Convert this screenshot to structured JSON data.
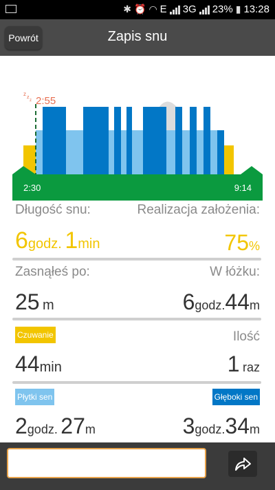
{
  "statusbar": {
    "network": "E",
    "network2": "3G",
    "battery": "23%",
    "time": "13:28"
  },
  "header": {
    "back_label": "Powrót",
    "title": "Zapis snu"
  },
  "chart_data": {
    "type": "bar",
    "start_time": "2:30",
    "end_time": "9:14",
    "sleep_onset": "2:55",
    "colors": {
      "awake": "#f2c500",
      "light": "#7fc4ee",
      "deep": "#0277c6",
      "baseline": "#0b9a3f"
    }
  },
  "stats": {
    "sleep_length": {
      "label": "Długość snu:",
      "hours": "6",
      "hours_unit": "godz.",
      "minutes": "1",
      "minutes_unit": "min"
    },
    "goal": {
      "label": "Realizacja założenia:",
      "value": "75",
      "unit": "%"
    },
    "fell_asleep": {
      "label": "Zasnąłeś po:",
      "value": "25",
      "unit": "m"
    },
    "in_bed": {
      "label": "W łóżku:",
      "hours": "6",
      "hours_unit": "godz.",
      "minutes": "44",
      "minutes_unit": "m"
    },
    "awake": {
      "label": "Czuwanie",
      "value": "44",
      "unit": "min"
    },
    "count": {
      "label": "Ilość",
      "value": "1",
      "unit": "raz"
    },
    "light": {
      "label": "Płytki sen",
      "hours": "2",
      "hours_unit": "godz.",
      "minutes": "27",
      "minutes_unit": "m"
    },
    "deep": {
      "label": "Głęboki sen",
      "hours": "3",
      "hours_unit": "godz.",
      "minutes": "34",
      "minutes_unit": "m"
    }
  },
  "note_input": {
    "value": ""
  }
}
